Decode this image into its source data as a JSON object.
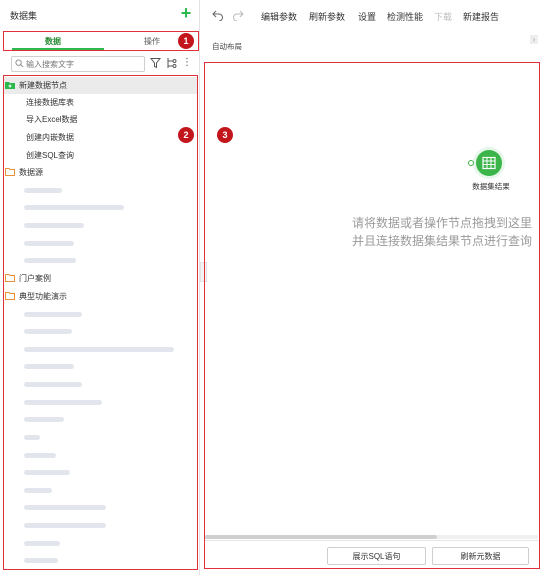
{
  "panel": {
    "title": "数据集"
  },
  "tabs": [
    {
      "label": "数据"
    },
    {
      "label": "操作"
    }
  ],
  "search": {
    "placeholder": "输入搜索文字"
  },
  "tree": {
    "new_node": "新建数据节点",
    "children": [
      "连接数据库表",
      "导入Excel数据",
      "创建内嵌数据",
      "创建SQL查询"
    ],
    "folders": [
      "数据源",
      "门户案例",
      "典型功能演示"
    ]
  },
  "toolbar": [
    {
      "label": "编辑参数"
    },
    {
      "label": "刷新参数"
    },
    {
      "label": "设置"
    },
    {
      "label": "检测性能"
    },
    {
      "label": "下载"
    },
    {
      "label": "新建报告"
    }
  ],
  "canvas": {
    "layout_label": "自动布局",
    "result_node": "数据集结果",
    "hint_line1": "请将数据或者操作节点拖拽到这里",
    "hint_line2": "并且连接数据集结果节点进行查询"
  },
  "footer": {
    "show_sql": "展示SQL语句",
    "refresh_meta": "刷新元数据"
  },
  "badges": [
    "1",
    "2",
    "3"
  ],
  "colors": {
    "accent_green": "#2db84d",
    "highlight_red": "#e0303a",
    "badge_red": "#c3161c",
    "folder_orange": "#e8903a"
  }
}
